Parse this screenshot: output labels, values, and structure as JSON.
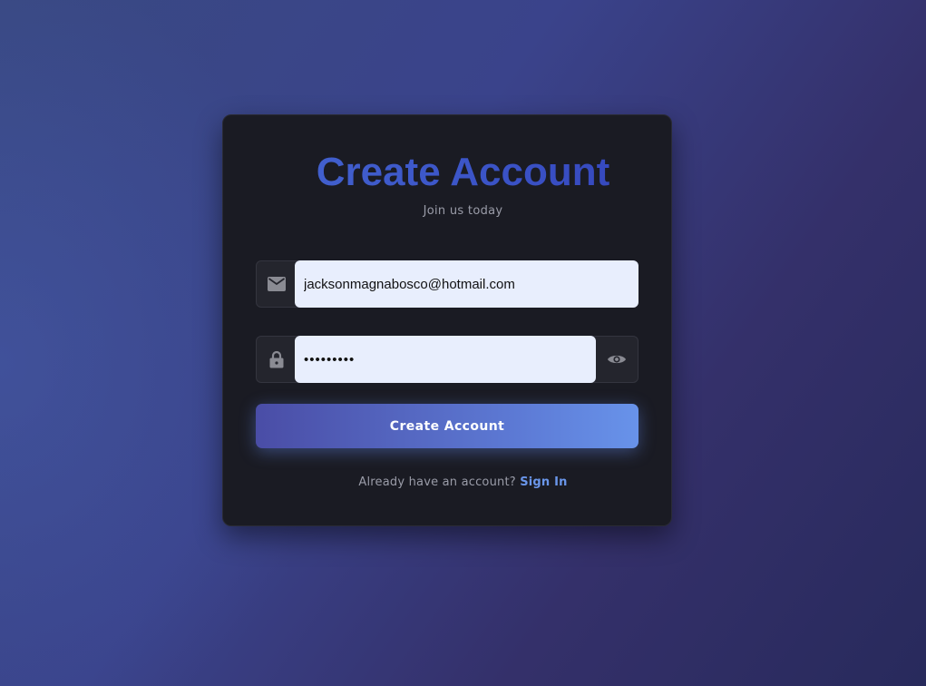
{
  "signup": {
    "title": "Create Account",
    "subtitle": "Join us today",
    "email": {
      "icon": "mail-icon",
      "value": "jacksonmagnabosco@hotmail.com"
    },
    "password": {
      "icon": "lock-icon",
      "value": "•••••••••",
      "toggle_icon": "eye-icon"
    },
    "submit_label": "Create Account",
    "footer": {
      "prompt": "Already have an account?",
      "link_label": "Sign In"
    }
  },
  "colors": {
    "background_start": "#394983",
    "background_end": "#282a5c",
    "card": "#1a1b23",
    "input_fill": "#e8eefd",
    "title_gradient_start": "#4d75d9",
    "title_gradient_end": "#2a2ea8",
    "button_gradient_start": "#4a4da6",
    "button_gradient_end": "#6893ea",
    "link": "#6a96ea",
    "muted_text": "#9a9ca8",
    "icon": "#8a8b93"
  }
}
